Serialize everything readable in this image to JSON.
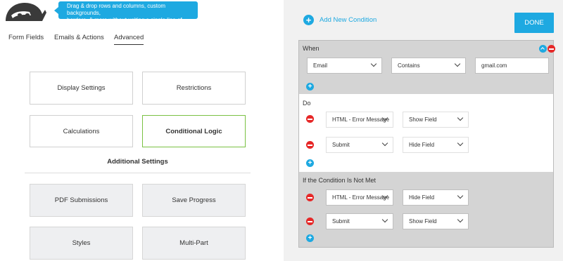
{
  "tooltip": {
    "line1": "Drag & drop rows and columns, custom backgrounds,",
    "line2": "borders, & more without writing a single line of code."
  },
  "tabs": [
    "Form Fields",
    "Emails & Actions",
    "Advanced"
  ],
  "active_tab": "Advanced",
  "cards_top": [
    "Display Settings",
    "Restrictions",
    "Calculations",
    "Conditional Logic"
  ],
  "active_card": "Conditional Logic",
  "additional_title": "Additional Settings",
  "cards_additional": [
    "PDF Submissions",
    "Save Progress",
    "Styles",
    "Multi-Part"
  ],
  "right": {
    "add_condition": "Add New Condition",
    "done": "DONE",
    "when": {
      "label": "When",
      "field": "Email",
      "operator": "Contains",
      "value": "gmail.com"
    },
    "do": {
      "label": "Do",
      "rows": [
        {
          "field": "HTML - Error Message",
          "action": "Show Field"
        },
        {
          "field": "Submit",
          "action": "Hide Field"
        }
      ]
    },
    "else": {
      "label": "If the Condition Is Not Met",
      "rows": [
        {
          "field": "HTML - Error Message",
          "action": "Hide Field"
        },
        {
          "field": "Submit",
          "action": "Show Field"
        }
      ]
    }
  },
  "colors": {
    "accent": "#1ea9e1",
    "active_border": "#7ac143",
    "remove": "#e62727"
  }
}
